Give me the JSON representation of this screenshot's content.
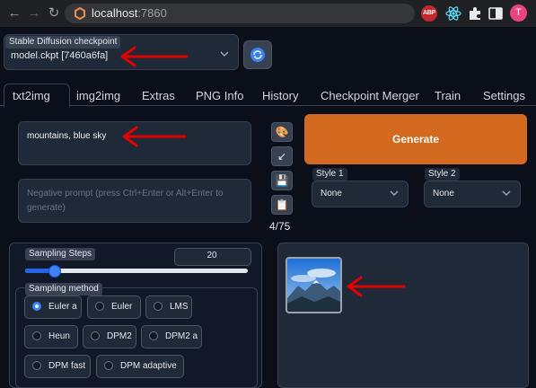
{
  "browser": {
    "url_host": "localhost",
    "url_port": ":7860",
    "ext_badge": "ABP",
    "profile_initial": "T"
  },
  "checkpoint": {
    "label": "Stable Diffusion checkpoint",
    "value": "model.ckpt [7460a6fa]"
  },
  "tabs": [
    {
      "label": "txt2img",
      "active": true
    },
    {
      "label": "img2img"
    },
    {
      "label": "Extras"
    },
    {
      "label": "PNG Info"
    },
    {
      "label": "History"
    },
    {
      "label": "Checkpoint Merger"
    },
    {
      "label": "Train"
    },
    {
      "label": "Settings"
    }
  ],
  "prompt": {
    "value": "mountains, blue sky",
    "negative_placeholder": "Negative prompt (press Ctrl+Enter or Alt+Enter to generate)",
    "token_count": "4/75"
  },
  "tools": [
    "palette-icon",
    "arrow-down-left-icon",
    "save-icon",
    "clipboard-icon"
  ],
  "generate": {
    "label": "Generate",
    "color": "#d2691e"
  },
  "styles": [
    {
      "label": "Style 1",
      "value": "None"
    },
    {
      "label": "Style 2",
      "value": "None"
    }
  ],
  "sampling_steps": {
    "label": "Sampling Steps",
    "value": "20",
    "min": 1,
    "max": 150
  },
  "sampling_method": {
    "label": "Sampling method",
    "options": [
      "Euler a",
      "Euler",
      "LMS",
      "Heun",
      "DPM2",
      "DPM2 a",
      "DPM fast",
      "DPM adaptive"
    ],
    "selected": "Euler a"
  },
  "annotation_color": "#e00000"
}
